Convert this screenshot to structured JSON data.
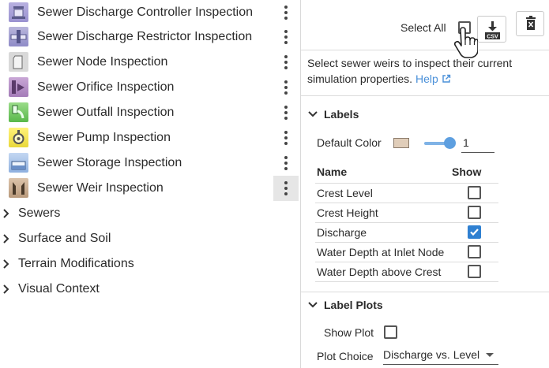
{
  "tree": {
    "items": [
      {
        "label": "Sewer Discharge Controller Inspection"
      },
      {
        "label": "Sewer Discharge Restrictor Inspection"
      },
      {
        "label": "Sewer Node Inspection"
      },
      {
        "label": "Sewer Orifice Inspection"
      },
      {
        "label": "Sewer Outfall Inspection"
      },
      {
        "label": "Sewer Pump Inspection"
      },
      {
        "label": "Sewer Storage Inspection"
      },
      {
        "label": "Sewer Weir Inspection"
      }
    ],
    "groups": [
      {
        "label": "Sewers"
      },
      {
        "label": "Surface and Soil"
      },
      {
        "label": "Terrain Modifications"
      },
      {
        "label": "Visual Context"
      }
    ]
  },
  "panel": {
    "select_all_label": "Select All",
    "csv_label": "CSV",
    "description": "Select sewer weirs to inspect their current simulation properties.",
    "help_label": "Help",
    "labels_section": {
      "title": "Labels",
      "default_color_label": "Default Color",
      "default_color": "#e0cdb9",
      "size_value": "1",
      "table_headers": {
        "name": "Name",
        "show": "Show"
      },
      "rows": [
        {
          "name": "Crest Level",
          "show": false
        },
        {
          "name": "Crest Height",
          "show": false
        },
        {
          "name": "Discharge",
          "show": true
        },
        {
          "name": "Water Depth at Inlet Node",
          "show": false
        },
        {
          "name": "Water Depth above Crest",
          "show": false
        }
      ]
    },
    "label_plots_section": {
      "title": "Label Plots",
      "show_plot_label": "Show Plot",
      "show_plot": false,
      "plot_choice_label": "Plot Choice",
      "plot_choice_value": "Discharge vs. Level"
    }
  },
  "colors": {
    "accent": "#2f80d1",
    "help_link": "#4a90d9"
  }
}
